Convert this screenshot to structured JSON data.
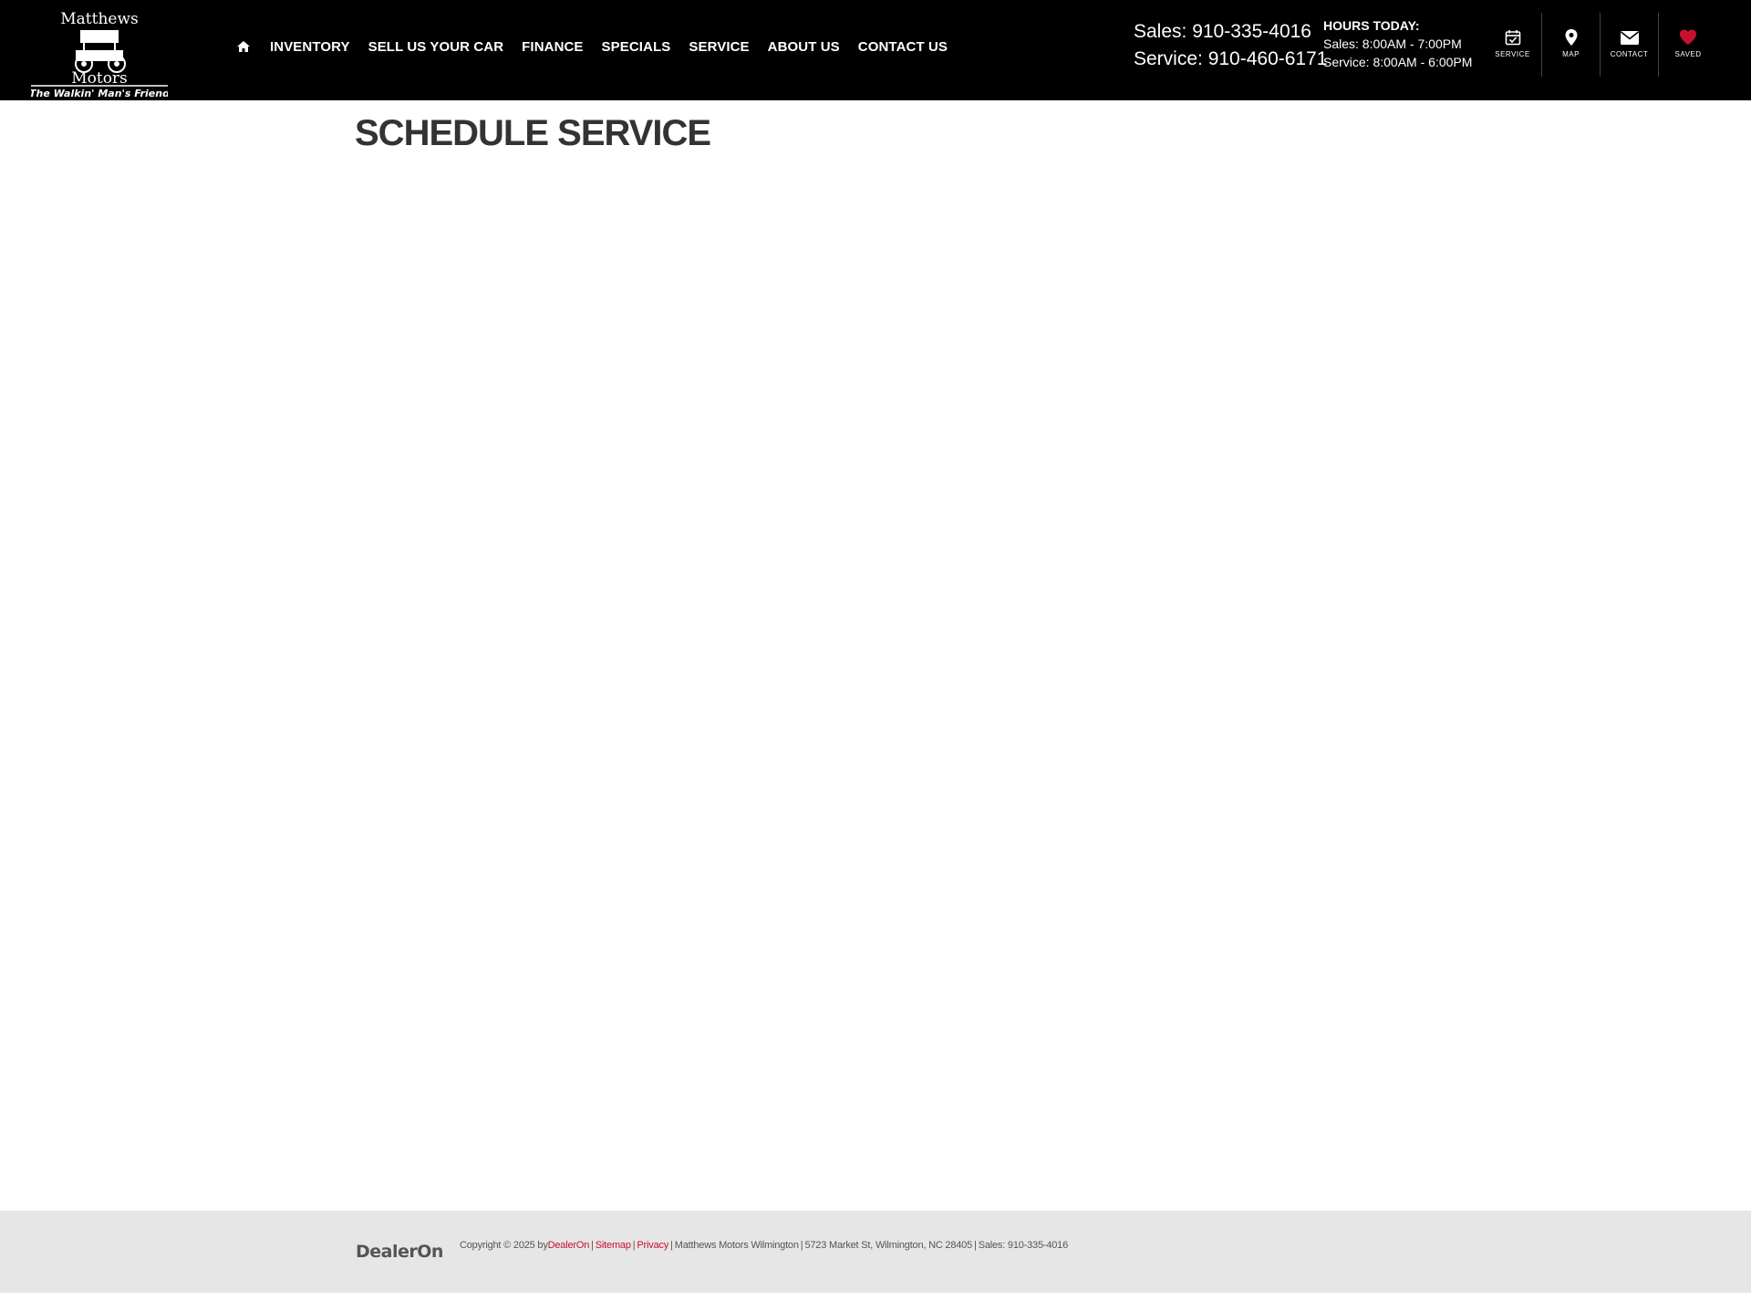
{
  "brand": {
    "logo_top": "Matthews",
    "logo_bottom": "Motors",
    "tagline": "The Walkin' Man's Friend"
  },
  "nav": {
    "home_icon": "home-icon",
    "items": [
      "INVENTORY",
      "SELL US YOUR CAR",
      "FINANCE",
      "SPECIALS",
      "SERVICE",
      "ABOUT US",
      "CONTACT US"
    ]
  },
  "phones": {
    "sales": "Sales: 910-335-4016",
    "service": "Service: 910-460-6171"
  },
  "hours": {
    "title": "HOURS TODAY:",
    "sales": "Sales: 8:00AM - 7:00PM",
    "service": "Service: 8:00AM - 6:00PM"
  },
  "quick_links": [
    {
      "label": "SERVICE",
      "icon": "calendar-check-icon"
    },
    {
      "label": "MAP",
      "icon": "map-pin-icon"
    },
    {
      "label": "CONTACT",
      "icon": "envelope-icon"
    },
    {
      "label": "SAVED",
      "icon": "heart-icon"
    }
  ],
  "page": {
    "title": "SCHEDULE SERVICE"
  },
  "footer": {
    "logo": "DealerOn",
    "copyright": "Copyright © 2025 by",
    "dealeron_link": "DealerOn",
    "sitemap": "Sitemap",
    "privacy": "Privacy",
    "dealer": "Matthews Motors Wilmington",
    "address": "5723 Market St, Wilmington, NC 28405",
    "sales": "Sales: 910-335-4016"
  },
  "colors": {
    "header_bg": "#000000",
    "accent_red": "#c8102e",
    "footer_bg": "#e6e6e6"
  }
}
